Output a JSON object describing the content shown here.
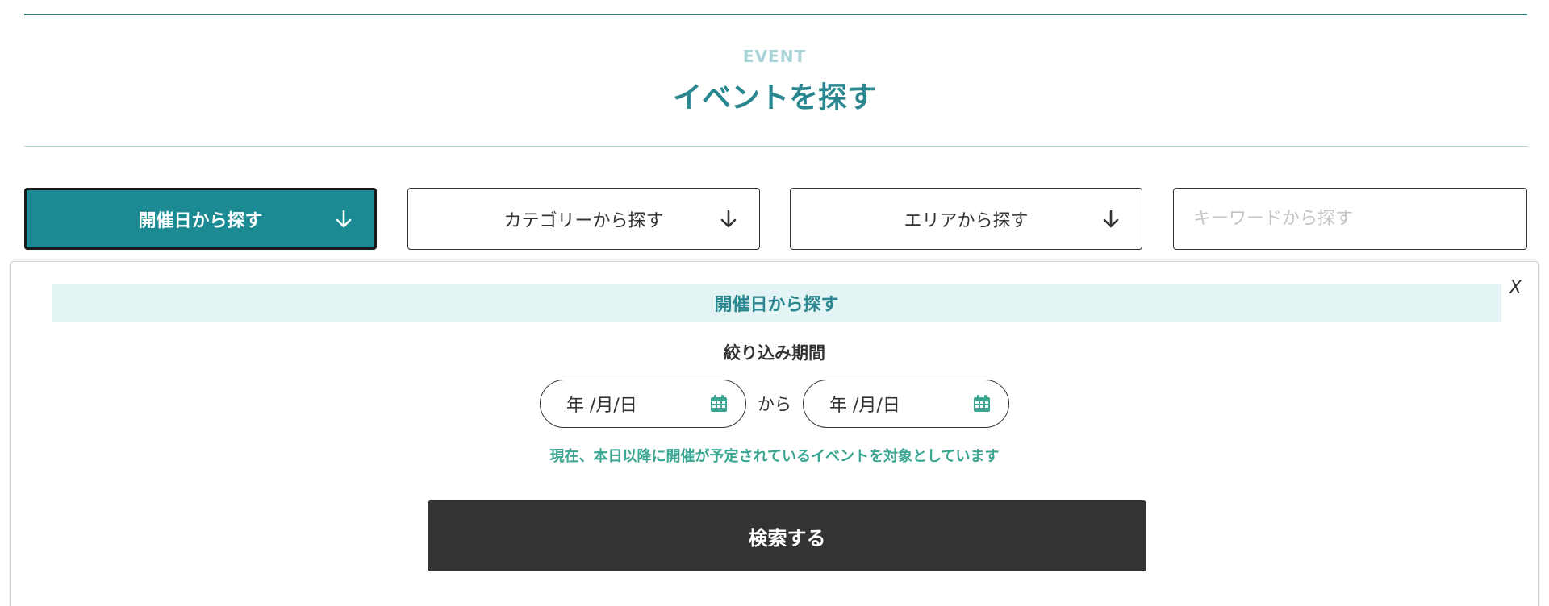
{
  "header": {
    "eyebrow": "EVENT",
    "title": "イベントを探す"
  },
  "filters": {
    "date": {
      "label": "開催日から探す",
      "icon": "arrow-down-icon",
      "active": true
    },
    "category": {
      "label": "カテゴリーから探す",
      "icon": "arrow-down-icon",
      "active": false
    },
    "area": {
      "label": "エリアから探す",
      "icon": "arrow-down-icon",
      "active": false
    },
    "keyword": {
      "placeholder": "キーワードから探す",
      "value": ""
    }
  },
  "panel": {
    "close_label": "X",
    "heading": "開催日から探す",
    "period_label": "絞り込み期間",
    "start_date": {
      "placeholder": "年 /月/日",
      "icon": "calendar-icon"
    },
    "separator": "から",
    "end_date": {
      "placeholder": "年 /月/日",
      "icon": "calendar-icon"
    },
    "note": "現在、本日以降に開催が予定されているイベントを対象としています",
    "search_label": "検索する"
  },
  "colors": {
    "accent": "#1c8a93",
    "title": "#2a8790",
    "eyebrow": "#a7d3d6",
    "note": "#3aa691",
    "panel_head_bg": "#e4f3f3",
    "dark": "#333333"
  }
}
